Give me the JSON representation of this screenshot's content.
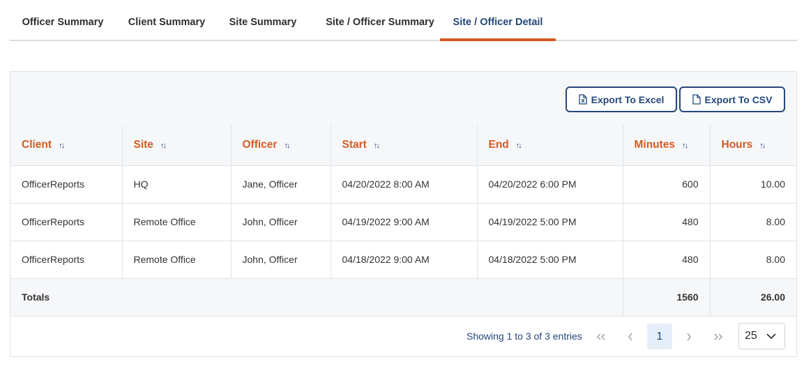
{
  "tabs": [
    {
      "label": "Officer Summary"
    },
    {
      "label": "Client Summary"
    },
    {
      "label": "Site Summary"
    },
    {
      "label": "Site / Officer Summary"
    },
    {
      "label": "Site / Officer Detail",
      "active": true
    }
  ],
  "toolbar": {
    "export_excel_label": "Export To Excel",
    "export_csv_label": "Export To CSV"
  },
  "table": {
    "columns": [
      "Client",
      "Site",
      "Officer",
      "Start",
      "End",
      "Minutes",
      "Hours"
    ],
    "rows": [
      [
        "OfficerReports",
        "HQ",
        "Jane, Officer",
        "04/20/2022 8:00 AM",
        "04/20/2022 6:00 PM",
        "600",
        "10.00"
      ],
      [
        "OfficerReports",
        "Remote Office",
        "John, Officer",
        "04/19/2022 9:00 AM",
        "04/19/2022 5:00 PM",
        "480",
        "8.00"
      ],
      [
        "OfficerReports",
        "Remote Office",
        "John, Officer",
        "04/18/2022 9:00 AM",
        "04/18/2022 5:00 PM",
        "480",
        "8.00"
      ]
    ],
    "totals": {
      "label": "Totals",
      "minutes": "1560",
      "hours": "26.00"
    }
  },
  "pagination": {
    "showing_text": "Showing 1 to 3 of 3 entries",
    "current_page": "1",
    "first_icon": "«",
    "prev_icon": "‹",
    "next_icon": "›",
    "last_icon": "»",
    "page_size": "25"
  },
  "colors": {
    "accent_orange": "#d45a22",
    "primary_navy": "#24477a",
    "header_bg": "#f6f7f9"
  }
}
